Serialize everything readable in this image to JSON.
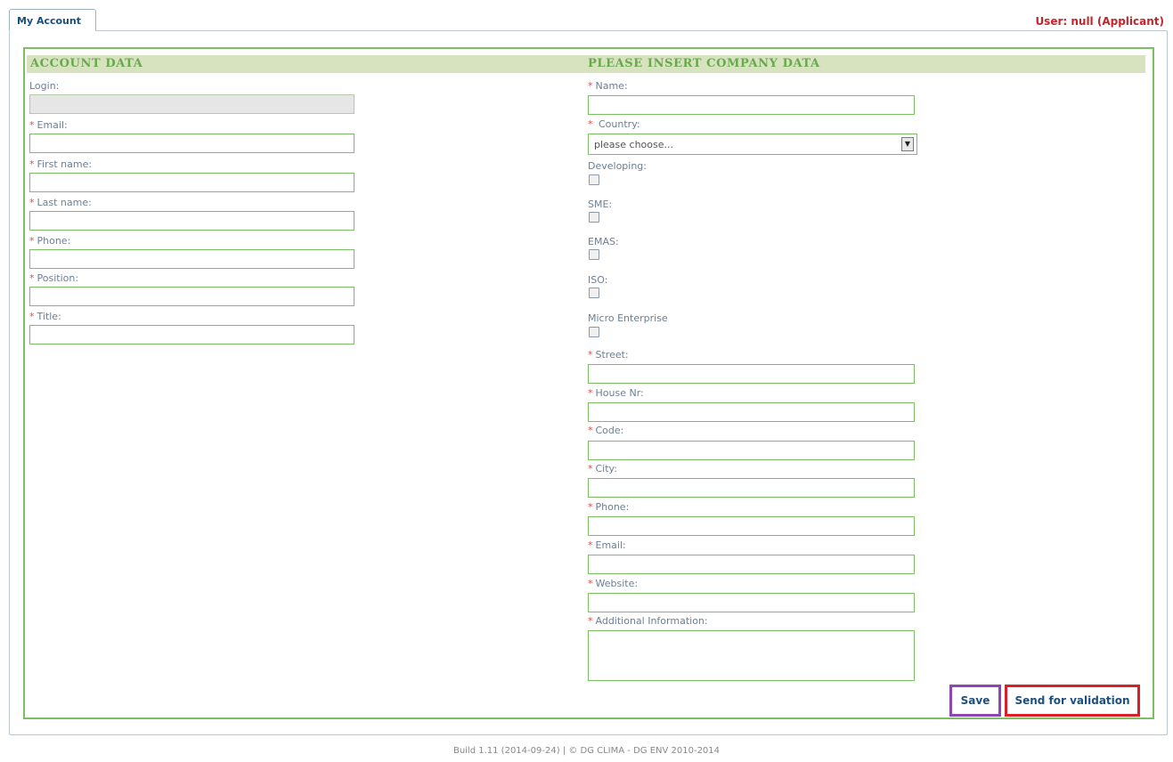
{
  "tab": {
    "label": "My Account"
  },
  "user_info": "User: null (Applicant)",
  "account": {
    "heading": "ACCOUNT DATA",
    "login_label": "Login:",
    "fields": [
      {
        "label": "Email:",
        "value": ""
      },
      {
        "label": "First name:",
        "value": ""
      },
      {
        "label": "Last name:",
        "value": ""
      },
      {
        "label": "Phone:",
        "value": ""
      },
      {
        "label": "Position:",
        "value": ""
      },
      {
        "label": "Title:",
        "value": ""
      }
    ]
  },
  "company": {
    "heading": "PLEASE INSERT COMPANY DATA",
    "name_label": "Name:",
    "country_label": "Country:",
    "country_value": "please choose...",
    "checkboxes": [
      {
        "label": "Developing:",
        "checked": false
      },
      {
        "label": "SME:",
        "checked": false
      },
      {
        "label": "EMAS:",
        "checked": false
      },
      {
        "label": "ISO:",
        "checked": false
      },
      {
        "label": "Micro Enterprise",
        "checked": false
      }
    ],
    "fields": [
      {
        "label": "Street:",
        "value": ""
      },
      {
        "label": "House Nr:",
        "value": ""
      },
      {
        "label": "Code:",
        "value": ""
      },
      {
        "label": "City:",
        "value": ""
      },
      {
        "label": "Phone:",
        "value": ""
      },
      {
        "label": "Email:",
        "value": ""
      },
      {
        "label": "Website:",
        "value": ""
      }
    ],
    "additional_label": "Additional Information:"
  },
  "required_mark": "*",
  "buttons": {
    "save": "Save",
    "send": "Send for validation"
  },
  "footer": "Build 1.11 (2014-09-24)  |  © DG CLIMA - DG ENV 2010-2014",
  "colors": {
    "accent_green": "#7bbf63",
    "header_bg": "#d6e3be",
    "user_red": "#c0262c",
    "save_outline": "#8e46b6",
    "send_outline": "#d81f2a"
  }
}
